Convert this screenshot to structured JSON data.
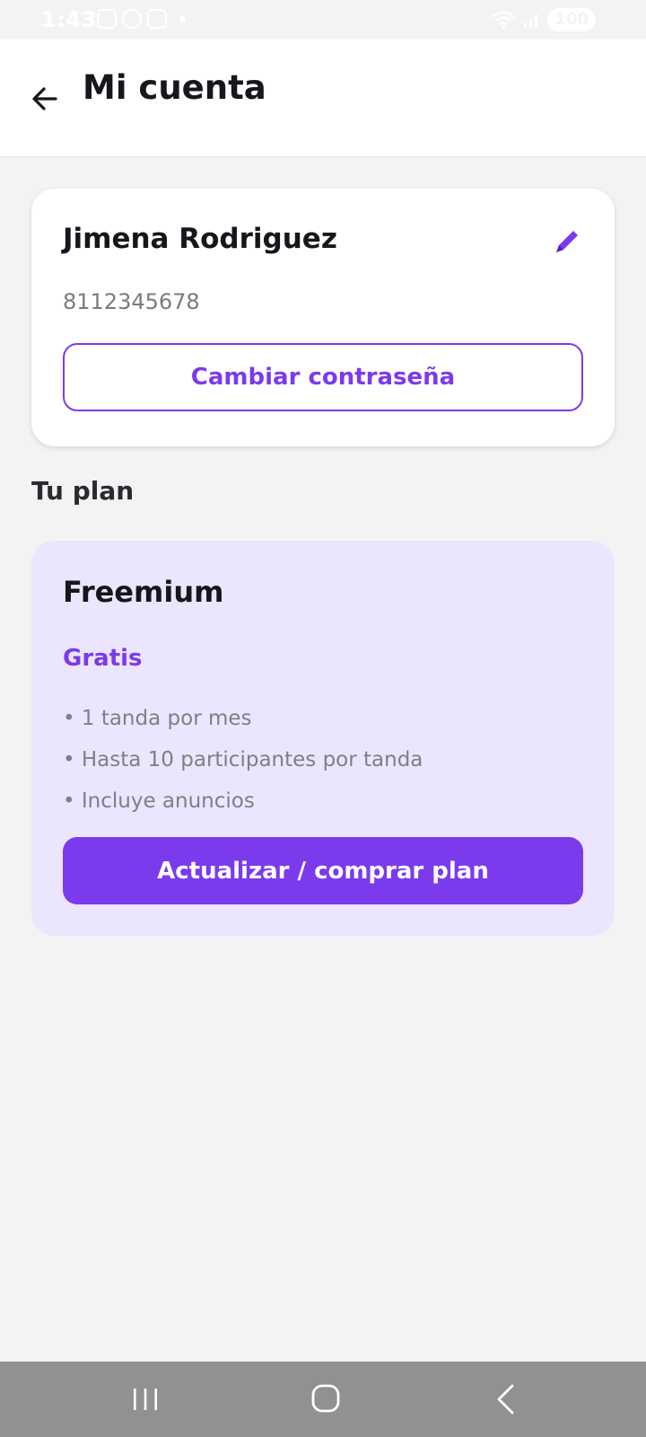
{
  "status_bar": {
    "time": "1:43",
    "battery": "100"
  },
  "header": {
    "title": "Mi cuenta"
  },
  "account": {
    "name": "Jimena Rodriguez",
    "phone": "8112345678",
    "change_password_label": "Cambiar contraseña"
  },
  "plan_section": {
    "title": "Tu plan",
    "plan_name": "Freemium",
    "price": "Gratis",
    "features": [
      "• 1 tanda por mes",
      "• Hasta 10 participantes por tanda",
      "• Incluye anuncios"
    ],
    "upgrade_label": "Actualizar / comprar plan"
  },
  "icons": {
    "back": "arrow-left-icon",
    "edit": "pencil-icon",
    "nav_recents": "recents-icon",
    "nav_home": "home-icon",
    "nav_back": "chevron-left-icon"
  },
  "colors": {
    "accent": "#7c3aed",
    "plan_background": "#ebe6fd",
    "page_background": "#f3f3f4"
  }
}
